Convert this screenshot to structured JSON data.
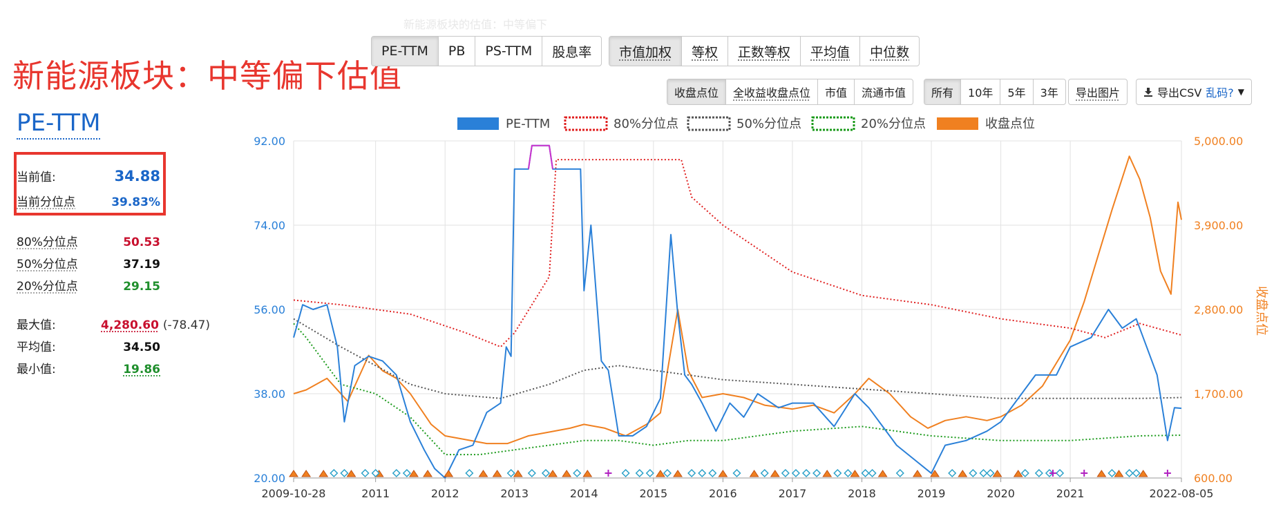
{
  "watermark": "新能源板块的估值：中等偏下",
  "headline": "新能源板块：中等偏下估值",
  "metric_tabs": [
    {
      "label": "PE-TTM",
      "active": true
    },
    {
      "label": "PB"
    },
    {
      "label": "PS-TTM"
    },
    {
      "label": "股息率"
    }
  ],
  "weight_tabs": [
    {
      "label": "市值加权",
      "active": true
    },
    {
      "label": "等权"
    },
    {
      "label": "正数等权"
    },
    {
      "label": "平均值"
    },
    {
      "label": "中位数"
    }
  ],
  "price_tabs": [
    {
      "label": "收盘点位",
      "active": true
    },
    {
      "label": "全收益收盘点位"
    },
    {
      "label": "市值"
    },
    {
      "label": "流通市值"
    }
  ],
  "range_tabs": [
    {
      "label": "所有",
      "active": true
    },
    {
      "label": "10年"
    },
    {
      "label": "5年"
    },
    {
      "label": "3年"
    }
  ],
  "export_image": "导出图片",
  "export_csv": {
    "label": "导出CSV",
    "link": "乱码?"
  },
  "sidebar": {
    "title": "PE-TTM",
    "current_value_label": "当前值:",
    "current_value": "34.88",
    "current_pct_label": "当前分位点",
    "current_pct": "39.83%",
    "p80_label": "80%分位点",
    "p80": "50.53",
    "p50_label": "50%分位点",
    "p50": "37.19",
    "p20_label": "20%分位点",
    "p20": "29.15",
    "max_label": "最大值:",
    "max": "4,280.60",
    "max_extra": "(-78.47)",
    "avg_label": "平均值:",
    "avg": "34.50",
    "min_label": "最小值:",
    "min": "19.86"
  },
  "chart_data": {
    "type": "line",
    "legend": [
      "PE-TTM",
      "80%分位点",
      "50%分位点",
      "20%分位点",
      "收盘点位"
    ],
    "legend_position": "top",
    "y_left_ticks": [
      "92.00",
      "74.00",
      "56.00",
      "38.00",
      "20.00"
    ],
    "y_left_range": [
      20,
      92
    ],
    "y_right_ticks": [
      "5,000.00",
      "3,900.00",
      "2,800.00",
      "1,700.00",
      "600.00"
    ],
    "y_right_range": [
      600,
      5000
    ],
    "y_right_label": "收盘点位",
    "x_ticks": [
      "2009-10-28",
      "2011",
      "2012",
      "2013",
      "2014",
      "2015",
      "2016",
      "2017",
      "2018",
      "2019",
      "2020",
      "2021",
      "2022-08-05"
    ],
    "x_range": [
      2009.82,
      2022.6
    ],
    "colors": {
      "pe": "#2a80d8",
      "p80": "#e02020",
      "p50": "#555555",
      "p20": "#1a9a1a",
      "close": "#f08020",
      "cap": "#cc33cc"
    },
    "series": [
      {
        "name": "PE-TTM",
        "axis": "left",
        "x": [
          2009.82,
          2009.95,
          2010.1,
          2010.3,
          2010.45,
          2010.55,
          2010.7,
          2010.9,
          2011.1,
          2011.3,
          2011.5,
          2011.7,
          2011.85,
          2012.0,
          2012.2,
          2012.4,
          2012.6,
          2012.8,
          2012.88,
          2012.95,
          2013.0,
          2013.2,
          2013.25,
          2013.5,
          2013.55,
          2013.8,
          2013.95,
          2014.0,
          2014.1,
          2014.25,
          2014.35,
          2014.5,
          2014.7,
          2014.9,
          2015.1,
          2015.25,
          2015.35,
          2015.45,
          2015.55,
          2015.7,
          2015.9,
          2016.1,
          2016.3,
          2016.5,
          2016.8,
          2017.0,
          2017.3,
          2017.6,
          2017.9,
          2018.1,
          2018.3,
          2018.5,
          2018.75,
          2019.0,
          2019.2,
          2019.5,
          2019.8,
          2020.0,
          2020.2,
          2020.5,
          2020.8,
          2021.0,
          2021.3,
          2021.55,
          2021.75,
          2021.95,
          2022.1,
          2022.25,
          2022.4,
          2022.5,
          2022.6
        ],
        "values": [
          50,
          57,
          56,
          57,
          48,
          32,
          44,
          46,
          45,
          42,
          32,
          26,
          22,
          20,
          26,
          27,
          34,
          36,
          48,
          46,
          86,
          86,
          91,
          91,
          86,
          86,
          86,
          60,
          74,
          45,
          43,
          29,
          29,
          31,
          37,
          72,
          55,
          42,
          40,
          36,
          30,
          36,
          33,
          38,
          35,
          36,
          36,
          31,
          38,
          35,
          31,
          27,
          24,
          21,
          27,
          28,
          30,
          32,
          36,
          42,
          42,
          48,
          50,
          56,
          52,
          54,
          48,
          42,
          28,
          35,
          34.88
        ]
      },
      {
        "name": "80%分位点",
        "axis": "left",
        "x": [
          2009.82,
          2010.5,
          2011.5,
          2012.3,
          2012.8,
          2013.0,
          2013.5,
          2013.6,
          2015.4,
          2015.55,
          2016.0,
          2017.0,
          2018.0,
          2019.0,
          2020.0,
          2021.0,
          2021.5,
          2022.0,
          2022.6
        ],
        "values": [
          58,
          57,
          55,
          51,
          48,
          51,
          63,
          88,
          88,
          80,
          74,
          64,
          59,
          57,
          54,
          52,
          50,
          53,
          50.53
        ]
      },
      {
        "name": "50%分位点",
        "axis": "left",
        "x": [
          2009.82,
          2010.5,
          2011.0,
          2011.5,
          2012.0,
          2012.8,
          2013.5,
          2014.0,
          2014.5,
          2015.0,
          2015.5,
          2016.0,
          2017.0,
          2018.0,
          2019.0,
          2020.0,
          2021.0,
          2022.0,
          2022.6
        ],
        "values": [
          54,
          48,
          44,
          40,
          38,
          37,
          40,
          43,
          44,
          43,
          42,
          41,
          40,
          39,
          38,
          37,
          37,
          37,
          37.19
        ]
      },
      {
        "name": "20%分位点",
        "axis": "left",
        "x": [
          2009.82,
          2010.0,
          2010.5,
          2011.0,
          2011.5,
          2012.0,
          2012.5,
          2013.0,
          2013.5,
          2014.0,
          2014.5,
          2015.0,
          2015.5,
          2016.0,
          2017.0,
          2018.0,
          2019.0,
          2020.0,
          2021.0,
          2022.0,
          2022.6
        ],
        "values": [
          53,
          50,
          40,
          38,
          33,
          25,
          25,
          26,
          27,
          28,
          28,
          27,
          28,
          28,
          30,
          31,
          29,
          28,
          28,
          29,
          29.15
        ]
      },
      {
        "name": "收盘点位",
        "axis": "right",
        "x": [
          2009.82,
          2010.0,
          2010.3,
          2010.6,
          2010.9,
          2011.1,
          2011.3,
          2011.5,
          2011.8,
          2012.0,
          2012.3,
          2012.6,
          2012.9,
          2013.2,
          2013.5,
          2013.8,
          2014.0,
          2014.3,
          2014.6,
          2014.9,
          2015.1,
          2015.35,
          2015.5,
          2015.7,
          2016.0,
          2016.3,
          2016.6,
          2017.0,
          2017.3,
          2017.6,
          2017.9,
          2018.1,
          2018.4,
          2018.7,
          2018.95,
          2019.2,
          2019.5,
          2019.8,
          2020.0,
          2020.3,
          2020.6,
          2020.8,
          2021.0,
          2021.2,
          2021.4,
          2021.6,
          2021.85,
          2022.0,
          2022.15,
          2022.3,
          2022.45,
          2022.55,
          2022.6
        ],
        "values": [
          1700,
          1750,
          1900,
          1600,
          2200,
          2000,
          1900,
          1700,
          1300,
          1150,
          1100,
          1050,
          1050,
          1150,
          1200,
          1250,
          1300,
          1250,
          1150,
          1300,
          1450,
          2800,
          2000,
          1650,
          1700,
          1650,
          1550,
          1500,
          1550,
          1450,
          1700,
          1900,
          1700,
          1400,
          1250,
          1350,
          1400,
          1350,
          1400,
          1550,
          1800,
          2100,
          2400,
          2900,
          3500,
          4100,
          4800,
          4500,
          4000,
          3300,
          3000,
          4200,
          3970
        ]
      }
    ],
    "markers": {
      "triangle": [
        2009.82,
        2010.0,
        2010.25,
        2010.65,
        2011.05,
        2011.55,
        2011.75,
        2012.05,
        2012.55,
        2012.75,
        2013.05,
        2013.55,
        2013.75,
        2014.05,
        2015.1,
        2015.35,
        2016.0,
        2016.45,
        2016.75,
        2017.5,
        2017.9,
        2018.3,
        2018.8,
        2019.05,
        2019.45,
        2019.95,
        2020.25,
        2021.45,
        2021.7,
        2022.05
      ],
      "diamond": [
        2010.4,
        2010.55,
        2010.85,
        2011.0,
        2011.3,
        2011.45,
        2012.35,
        2012.95,
        2013.25,
        2013.45,
        2013.9,
        2014.6,
        2014.8,
        2014.95,
        2015.2,
        2015.55,
        2015.7,
        2015.85,
        2016.2,
        2016.6,
        2016.9,
        2017.05,
        2017.2,
        2017.35,
        2017.65,
        2017.8,
        2018.05,
        2018.15,
        2018.55,
        2019.3,
        2019.6,
        2019.75,
        2019.85,
        2020.35,
        2020.55,
        2020.7,
        2020.85,
        2021.6,
        2021.85,
        2021.95
      ],
      "plus": [
        2014.35,
        2020.75,
        2021.2,
        2022.4
      ]
    }
  }
}
